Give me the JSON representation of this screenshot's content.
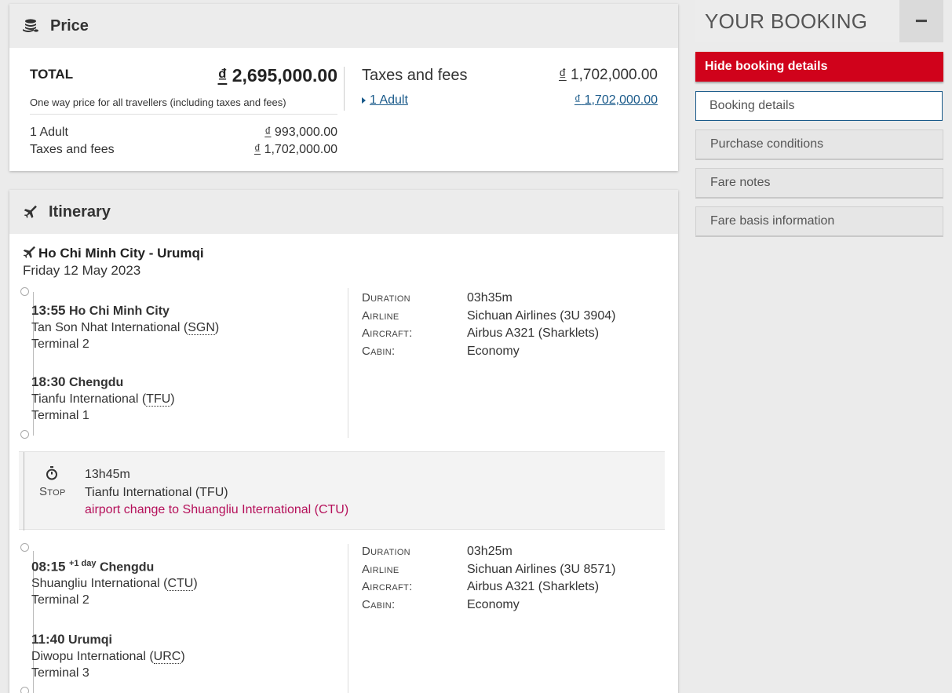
{
  "price": {
    "title": "Price",
    "total_label": "TOTAL",
    "total_amount": "2,695,000.00",
    "currency_symbol": "₫",
    "one_way_note": "One way price for all travellers (including taxes and fees)",
    "adult_label": "1 Adult",
    "adult_amount": "993,000.00",
    "taxes_label": "Taxes and fees",
    "taxes_amount": "1,702,000.00",
    "right_taxes_label": "Taxes and fees",
    "right_taxes_amount": "1,702,000.00",
    "right_adult_link": "1 Adult",
    "right_adult_amount": "1,702,000.00"
  },
  "itinerary": {
    "title": "Itinerary",
    "route": "Ho Chi Minh City - Urumqi",
    "date": "Friday 12 May 2023",
    "segments": [
      {
        "dep_time": "13:55",
        "dep_city": "Ho Chi Minh City",
        "dep_airport": "Tan Son Nhat International",
        "dep_code": "SGN",
        "dep_terminal": "Terminal 2",
        "arr_time": "18:30",
        "arr_day_offset": "",
        "arr_city": "Chengdu",
        "arr_airport": "Tianfu International",
        "arr_code": "TFU",
        "arr_terminal": "Terminal 1",
        "duration_label": "Duration",
        "duration": "03h35m",
        "airline_label": "Airline",
        "airline": "Sichuan Airlines (3U 3904)",
        "aircraft_label": "Aircraft:",
        "aircraft": "Airbus A321 (Sharklets)",
        "cabin_label": "Cabin:",
        "cabin": "Economy"
      },
      {
        "dep_time": "08:15",
        "dep_day_offset": "+1 day",
        "dep_city": "Chengdu",
        "dep_airport": "Shuangliu International",
        "dep_code": "CTU",
        "dep_terminal": "Terminal 2",
        "arr_time": "11:40",
        "arr_city": "Urumqi",
        "arr_airport": "Diwopu International",
        "arr_code": "URC",
        "arr_terminal": "Terminal 3",
        "duration_label": "Duration",
        "duration": "03h25m",
        "airline_label": "Airline",
        "airline": "Sichuan Airlines (3U 8571)",
        "aircraft_label": "Aircraft:",
        "aircraft": "Airbus A321 (Sharklets)",
        "cabin_label": "Cabin:",
        "cabin": "Economy"
      }
    ],
    "stop": {
      "label": "Stop",
      "duration": "13h45m",
      "airport": "Tianfu International (TFU)",
      "airport_change": "airport change to Shuangliu International (CTU)"
    }
  },
  "sidebar": {
    "title": "YOUR BOOKING",
    "collapse_symbol": "−",
    "hide_button": "Hide booking details",
    "items": [
      {
        "label": "Booking details"
      },
      {
        "label": "Purchase conditions"
      },
      {
        "label": "Fare notes"
      },
      {
        "label": "Fare basis information"
      }
    ]
  },
  "colors": {
    "accent_red": "#d0021b",
    "link_blue": "#1a5a8a",
    "airport_change": "#b5105a"
  },
  "icons": {
    "price": "coins-icon",
    "itinerary": "plane-icon",
    "stop": "stopwatch-icon"
  }
}
